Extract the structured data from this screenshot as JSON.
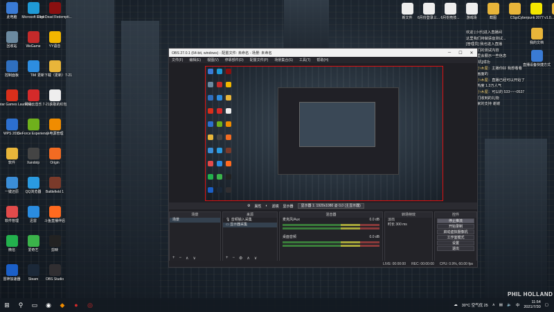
{
  "desktop_icons_left": [
    {
      "label": "此电脑",
      "icon": "computer-icon",
      "color": "#3a7bd5"
    },
    {
      "label": "Microsoft Edge",
      "icon": "edge-icon",
      "color": "#1f9ad6"
    },
    {
      "label": "Red Dead Redempti...",
      "icon": "rdr-icon",
      "color": "#8a1010"
    },
    {
      "label": "回收站",
      "icon": "recycle-bin-icon",
      "color": "#6c8aa0"
    },
    {
      "label": "WeGame",
      "icon": "wegame-icon",
      "color": "#c42a2a"
    },
    {
      "label": "YY语音",
      "icon": "yy-icon",
      "color": "#f2b600"
    },
    {
      "label": "控制面板",
      "icon": "control-panel-icon",
      "color": "#2f6fbf"
    },
    {
      "label": "TIM",
      "icon": "tim-icon",
      "color": "#2d8de0"
    },
    {
      "label": "更新下载（更新）7-21",
      "icon": "folder-icon",
      "color": "#e8b53a"
    },
    {
      "label": "Rockstar Games Launcher",
      "icon": "rockstar-icon",
      "color": "#d92f1b"
    },
    {
      "label": "网易云音乐",
      "icon": "netease-music-icon",
      "color": "#d42a2a"
    },
    {
      "label": "7-21获取的红包",
      "icon": "document-icon",
      "color": "#eeeeee"
    },
    {
      "label": "WPS 2019",
      "icon": "wps-icon",
      "color": "#2c6fcf"
    },
    {
      "label": "GeForce Experience",
      "icon": "geforce-icon",
      "color": "#6fb11c"
    },
    {
      "label": "小电源管理",
      "icon": "power-icon",
      "color": "#f08c00"
    },
    {
      "label": "软件",
      "icon": "folder-icon",
      "color": "#e8b53a"
    },
    {
      "label": "Xandolp",
      "icon": "xandolp-icon",
      "color": "#444444"
    },
    {
      "label": "Origin",
      "icon": "origin-icon",
      "color": "#f26b22"
    },
    {
      "label": "一键还原",
      "icon": "restore-icon",
      "color": "#3b8ed8"
    },
    {
      "label": "QQ浏览器",
      "icon": "qq-browser-icon",
      "color": "#2a9ae0"
    },
    {
      "label": "Battlefield 1",
      "icon": "battlefield-icon",
      "color": "#7a3a2a"
    },
    {
      "label": "软件管理",
      "icon": "software-manager-icon",
      "color": "#e24b4b"
    },
    {
      "label": "迅雷",
      "icon": "xunlei-icon",
      "color": "#2a8ce0"
    },
    {
      "label": "斗鱼直播伴侣",
      "icon": "douyu-icon",
      "color": "#ff6a1f"
    },
    {
      "label": "微信",
      "icon": "wechat-icon",
      "color": "#23b14d"
    },
    {
      "label": "爱奇艺",
      "icon": "iqiyi-icon",
      "color": "#3bb34a"
    },
    {
      "label": "剪映",
      "icon": "jianying-icon",
      "color": "#222222"
    },
    {
      "label": "雷神加速器",
      "icon": "leishen-icon",
      "color": "#1b5fc7"
    },
    {
      "label": "Steam",
      "icon": "steam-icon",
      "color": "#1b2838"
    },
    {
      "label": "OBS Studio",
      "icon": "obs-icon",
      "color": "#302e31"
    }
  ],
  "desktop_icons_right": [
    {
      "label": "新文件",
      "icon": "document-icon",
      "color": "#eeeeee"
    },
    {
      "label": "6月份登录三...",
      "icon": "document-icon",
      "color": "#eeeeee"
    },
    {
      "label": "6月份竞技...",
      "icon": "document-icon",
      "color": "#eeeeee"
    },
    {
      "label": "游戏场",
      "icon": "document-icon",
      "color": "#eeeeee"
    },
    {
      "label": "截图",
      "icon": "folder-icon",
      "color": "#e8b53a"
    },
    {
      "label": "CSgo",
      "icon": "folder-icon",
      "color": "#e8b53a"
    },
    {
      "label": "Cyberpunk 2077 v1.0...",
      "icon": "cyberpunk-icon",
      "color": "#f3e600"
    },
    {
      "label": "jj",
      "icon": "folder-icon",
      "color": "#e8b53a"
    },
    {
      "label": "我的文档",
      "icon": "folder-icon",
      "color": "#e8b53a"
    },
    {
      "label": "直播设备快捷方式",
      "icon": "shortcut-icon",
      "color": "#3a7bd5"
    }
  ],
  "chat": [
    {
      "user": "",
      "text": "欢迎 [小乐]进入直播间"
    },
    {
      "user": "",
      "text": "这里我们将做语音测试..."
    },
    {
      "user": "",
      "text": "[管理员] 我也进入直播"
    },
    {
      "user": "",
      "text": "这是我们的测试内容"
    },
    {
      "user": "",
      "text": "我们这里会展示一些信息"
    },
    {
      "user": "",
      "text": "测试[手机]成功"
    },
    {
      "user": "罗德的小木屋",
      "text": "：主播你好 我想看看"
    },
    {
      "user": "",
      "text": "作游戏画面的"
    },
    {
      "user": "罗德的小木屋",
      "text": "：直播已经可以开始了"
    },
    {
      "user": "",
      "text": "直播间热度 1.3万人气"
    },
    {
      "user": "罗德的小木屋",
      "text": "：可以的 533~~~0537"
    },
    {
      "user": "",
      "text": "这里我们收到的礼物"
    },
    {
      "user": "",
      "text": "感谢大家的支持 谢谢"
    }
  ],
  "obs": {
    "title": "OBS 27.0.1 (64-bit, windows) - 配置文件: 未命名 - 场景: 未命名",
    "menu": [
      "文件(F)",
      "编辑(E)",
      "视图(V)",
      "停靠部件(D)",
      "配置文件(P)",
      "场景集合(S)",
      "工具(T)",
      "帮助(H)"
    ],
    "source_bar": {
      "properties": "属性",
      "filters": "滤镜",
      "display_label": "显示器",
      "display_value": "显示器 1: 1920x1080 @ 0,0 (主显示器)"
    },
    "scenes": {
      "header": "场景",
      "items": [
        "场景"
      ]
    },
    "sources": {
      "header": "来源",
      "items": [
        "音频输入采集",
        "显示器采集"
      ]
    },
    "mixer": {
      "header": "混音器",
      "channels": [
        {
          "name": "麦克风/Aux",
          "db": "0.0 dB"
        },
        {
          "name": "桌面音频",
          "db": "0.0 dB"
        }
      ]
    },
    "transitions": {
      "header": "转场特效",
      "type": "淡出",
      "duration_label": "时长",
      "duration": "300 ms"
    },
    "controls": {
      "header": "控件",
      "buttons": [
        "停止推流",
        "开始录制",
        "启动虚拟摄像机",
        "工作室模式",
        "设置",
        "退出"
      ]
    },
    "status": {
      "live": "LIVE: 00:00:00",
      "rec": "REC: 00:00:00",
      "cpu": "CPU: 0.9%, 60.00 fps"
    }
  },
  "taskbar": {
    "weather": "30°C 空气优 25",
    "ime": "中",
    "time": "11:54",
    "date": "2021/7/30"
  },
  "watermark": "PHIL HOLLAND"
}
